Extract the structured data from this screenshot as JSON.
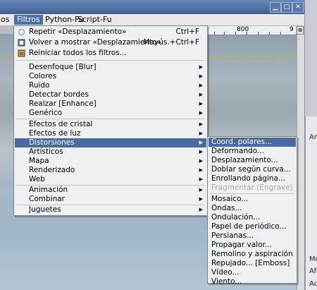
{
  "window": {
    "minimize_label": "▁",
    "maximize_label": "□",
    "close_label": "✕"
  },
  "menubar": {
    "items": [
      {
        "label": "os"
      },
      {
        "label": "Filtros"
      },
      {
        "label": "Python-Fu"
      },
      {
        "label": "Script-Fu"
      }
    ]
  },
  "ruler": {
    "labels": [
      "800",
      "9"
    ]
  },
  "right_panel": {
    "labels": [
      "Ar",
      "Mov",
      "Afe",
      "Ac"
    ]
  },
  "filters_menu": {
    "top_items": [
      {
        "label": "Repetir «Desplazamiento»",
        "accel": "Ctrl+F",
        "icon": "repeat-icon"
      },
      {
        "label": "Volver a mostrar «Desplazamiento»",
        "accel": "Mayús.+Ctrl+F",
        "icon": "reshow-icon"
      },
      {
        "label": "Reiniciar todos los filtros...",
        "accel": "",
        "icon": "reset-icon"
      }
    ],
    "group1": [
      "Desenfoque [Blur]",
      "Colores",
      "Ruido",
      "Detectar bordes",
      "Realzar [Enhance]",
      "Genérico"
    ],
    "group2": [
      "Efectos de cristal",
      "Efectos de luz",
      "Distorsiones",
      "Artísticos",
      "Mapa",
      "Renderizado",
      "Web"
    ],
    "group3": [
      "Animación",
      "Combinar"
    ],
    "group4": [
      "Juguetes"
    ]
  },
  "distorsiones_menu": {
    "items": [
      "Coord. polares...",
      "Deformando...",
      "Desplazamiento...",
      "Doblar según curva...",
      "Enrollando página...",
      "Fragmentar (Engrave)",
      "Mosaico...",
      "Ondas...",
      "Ondulación...",
      "Papel de periódico...",
      "Persianas...",
      "Propagar valor...",
      "Remolino y aspiración",
      "Repujado... [Emboss]",
      "Vídeo...",
      "Viento..."
    ]
  }
}
